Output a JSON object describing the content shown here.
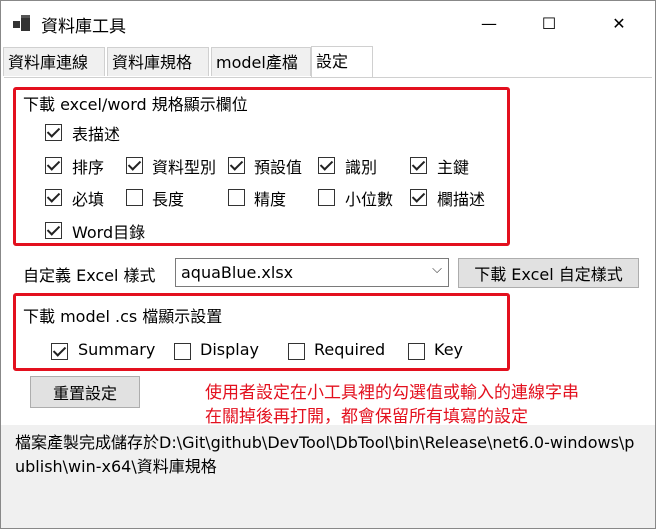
{
  "window": {
    "title": "資料庫工具",
    "minimize": "—",
    "maximize": "☐",
    "close": "✕"
  },
  "tabs": [
    "資料庫連線",
    "資料庫規格",
    "model產檔",
    "設定"
  ],
  "download_section": {
    "title": "下載 excel/word 規格顯示欄位",
    "options": [
      {
        "label": "表描述",
        "checked": true
      },
      {
        "label": "排序",
        "checked": true
      },
      {
        "label": "資料型別",
        "checked": true
      },
      {
        "label": "預設值",
        "checked": true
      },
      {
        "label": "識別",
        "checked": true
      },
      {
        "label": "主鍵",
        "checked": true
      },
      {
        "label": "必填",
        "checked": true
      },
      {
        "label": "長度",
        "checked": false
      },
      {
        "label": "精度",
        "checked": false
      },
      {
        "label": "小位數",
        "checked": false
      },
      {
        "label": "欄描述",
        "checked": true
      },
      {
        "label": "Word目錄",
        "checked": true
      }
    ]
  },
  "excel_style": {
    "label": "自定義 Excel 樣式",
    "value": "aquaBlue.xlsx",
    "download_button": "下載 Excel 自定樣式"
  },
  "model_section": {
    "title": "下載 model .cs 檔顯示設置",
    "options": [
      {
        "label": "Summary",
        "checked": true
      },
      {
        "label": "Display",
        "checked": false
      },
      {
        "label": "Required",
        "checked": false
      },
      {
        "label": "Key",
        "checked": false
      }
    ]
  },
  "reset_button": "重置設定",
  "note": {
    "line1": "使用者設定在小工具裡的勾選值或輸入的連線字串",
    "line2": "在關掉後再打開，都會保留所有填寫的設定"
  },
  "status": "檔案產製完成儲存於D:\\Git\\github\\DevTool\\DbTool\\bin\\Release\\net6.0-windows\\publish\\win-x64\\資料庫規格",
  "colors": {
    "highlight_border": "#e3101e",
    "note_text": "#e3101e",
    "status_bg": "#f0f0f0"
  }
}
